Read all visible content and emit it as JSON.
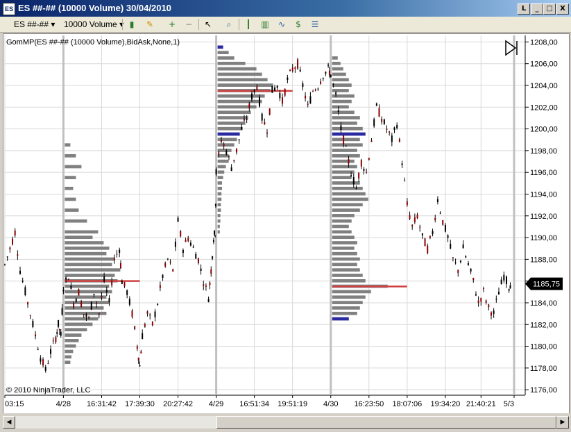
{
  "window": {
    "title": "ES ##-## (10000 Volume)  30/04/2010",
    "icon_label": "ES",
    "buttons": {
      "minimize": "_",
      "restore": "□",
      "close": "X",
      "extra": "L"
    }
  },
  "toolbar": {
    "instrument": "ES ##-##",
    "period": "10000 Volume",
    "icons": [
      "bar-style-icon",
      "drawing-pencil-icon",
      "zoom-in-icon",
      "zoom-out-icon",
      "cursor-icon",
      "search-icon",
      "bars-icon",
      "candles-icon",
      "indicator-icon",
      "strategy-icon",
      "properties-icon"
    ]
  },
  "chart_data": {
    "type": "candlestick",
    "indicator_label": "GomMP(ES ##-## (10000 Volume),BidAsk,None,1)",
    "copyright": "© 2010 NinjaTrader, LLC",
    "current_price": "1185,75",
    "last_price_value": 1185.75,
    "ylim": [
      1175.5,
      1208.6
    ],
    "y_ticks": [
      "1176,00",
      "1178,00",
      "1180,00",
      "1182,00",
      "1184,00",
      "1186,00",
      "1188,00",
      "1190,00",
      "1192,00",
      "1194,00",
      "1196,00",
      "1198,00",
      "1200,00",
      "1202,00",
      "1204,00",
      "1206,00",
      "1208,00"
    ],
    "y_tick_values": [
      1176,
      1178,
      1180,
      1182,
      1184,
      1186,
      1188,
      1190,
      1192,
      1194,
      1196,
      1198,
      1200,
      1202,
      1204,
      1206,
      1208
    ],
    "x_ticks": [
      "03:15",
      "4/28",
      "16:31:42",
      "17:39:30",
      "20:27:42",
      "4/29",
      "16:51:34",
      "19:51:19",
      "4/30",
      "16:23:50",
      "18:07:06",
      "19:34:20",
      "21:40:21",
      "5/3"
    ],
    "x_tick_fraction": [
      0.0,
      0.115,
      0.19,
      0.265,
      0.34,
      0.415,
      0.49,
      0.565,
      0.64,
      0.715,
      0.79,
      0.865,
      0.935,
      1.0
    ],
    "session_breaks_fraction": [
      0.115,
      0.415,
      0.64,
      1.0
    ],
    "price_path": [
      [
        0.0,
        1187.5
      ],
      [
        0.01,
        1189
      ],
      [
        0.02,
        1190.5
      ],
      [
        0.03,
        1187
      ],
      [
        0.04,
        1185
      ],
      [
        0.05,
        1183
      ],
      [
        0.06,
        1181
      ],
      [
        0.07,
        1179
      ],
      [
        0.08,
        1177.8
      ],
      [
        0.09,
        1179.5
      ],
      [
        0.1,
        1180.8
      ],
      [
        0.105,
        1182
      ],
      [
        0.11,
        1181
      ],
      [
        0.115,
        1185.5
      ],
      [
        0.125,
        1186.5
      ],
      [
        0.135,
        1184
      ],
      [
        0.145,
        1185
      ],
      [
        0.155,
        1183
      ],
      [
        0.165,
        1182.5
      ],
      [
        0.175,
        1185
      ],
      [
        0.185,
        1183
      ],
      [
        0.195,
        1186
      ],
      [
        0.205,
        1184
      ],
      [
        0.215,
        1188
      ],
      [
        0.225,
        1189
      ],
      [
        0.23,
        1186
      ],
      [
        0.24,
        1185
      ],
      [
        0.25,
        1183
      ],
      [
        0.26,
        1180
      ],
      [
        0.265,
        1178.2
      ],
      [
        0.27,
        1181
      ],
      [
        0.28,
        1183
      ],
      [
        0.29,
        1182
      ],
      [
        0.3,
        1184
      ],
      [
        0.31,
        1186.5
      ],
      [
        0.32,
        1188
      ],
      [
        0.33,
        1187
      ],
      [
        0.34,
        1191.5
      ],
      [
        0.35,
        1189
      ],
      [
        0.36,
        1190
      ],
      [
        0.37,
        1189
      ],
      [
        0.38,
        1188
      ],
      [
        0.39,
        1186
      ],
      [
        0.4,
        1184.5
      ],
      [
        0.405,
        1187
      ],
      [
        0.41,
        1190
      ],
      [
        0.413,
        1190.5
      ],
      [
        0.415,
        1196
      ],
      [
        0.425,
        1199
      ],
      [
        0.435,
        1198
      ],
      [
        0.445,
        1196.5
      ],
      [
        0.455,
        1198
      ],
      [
        0.465,
        1200
      ],
      [
        0.475,
        1201
      ],
      [
        0.485,
        1203
      ],
      [
        0.495,
        1204
      ],
      [
        0.505,
        1201
      ],
      [
        0.515,
        1200
      ],
      [
        0.525,
        1203.5
      ],
      [
        0.535,
        1204
      ],
      [
        0.545,
        1202.5
      ],
      [
        0.555,
        1204.5
      ],
      [
        0.565,
        1205.5
      ],
      [
        0.575,
        1206
      ],
      [
        0.585,
        1204
      ],
      [
        0.595,
        1202
      ],
      [
        0.605,
        1203.5
      ],
      [
        0.615,
        1204
      ],
      [
        0.625,
        1205
      ],
      [
        0.635,
        1205.5
      ],
      [
        0.64,
        1205
      ],
      [
        0.65,
        1203
      ],
      [
        0.66,
        1200
      ],
      [
        0.67,
        1198
      ],
      [
        0.68,
        1196
      ],
      [
        0.69,
        1194.5
      ],
      [
        0.7,
        1197
      ],
      [
        0.71,
        1196
      ],
      [
        0.72,
        1199
      ],
      [
        0.73,
        1202
      ],
      [
        0.74,
        1201
      ],
      [
        0.75,
        1200
      ],
      [
        0.76,
        1199
      ],
      [
        0.77,
        1200.5
      ],
      [
        0.78,
        1197
      ],
      [
        0.79,
        1193
      ],
      [
        0.8,
        1191
      ],
      [
        0.81,
        1192
      ],
      [
        0.82,
        1190
      ],
      [
        0.83,
        1189
      ],
      [
        0.84,
        1190.5
      ],
      [
        0.85,
        1193.5
      ],
      [
        0.86,
        1191.5
      ],
      [
        0.87,
        1190
      ],
      [
        0.88,
        1188
      ],
      [
        0.89,
        1187
      ],
      [
        0.9,
        1189
      ],
      [
        0.91,
        1187.5
      ],
      [
        0.92,
        1186
      ],
      [
        0.93,
        1184
      ],
      [
        0.94,
        1185
      ],
      [
        0.95,
        1183.5
      ],
      [
        0.96,
        1183
      ],
      [
        0.97,
        1185
      ],
      [
        0.98,
        1186.5
      ],
      [
        0.99,
        1185.5
      ],
      [
        0.995,
        1186
      ]
    ],
    "profiles": [
      {
        "session": "4/28",
        "start_fraction": 0.115,
        "poc": 1186,
        "value_area_blue": [
          1182.2,
          1189.7
        ],
        "levels": [
          [
            1198.5,
            0.1
          ],
          [
            1197.5,
            0.2
          ],
          [
            1196.5,
            0.3
          ],
          [
            1195.5,
            0.2
          ],
          [
            1194.5,
            0.15
          ],
          [
            1193.5,
            0.2
          ],
          [
            1192.5,
            0.25
          ],
          [
            1191.5,
            0.4
          ],
          [
            1190.5,
            0.6
          ],
          [
            1190,
            0.5
          ],
          [
            1189.5,
            0.7
          ],
          [
            1189,
            0.8
          ],
          [
            1188.5,
            0.75
          ],
          [
            1188,
            0.9
          ],
          [
            1187.5,
            0.85
          ],
          [
            1187,
            1.0
          ],
          [
            1186.5,
            0.9
          ],
          [
            1186,
            0.95
          ],
          [
            1185.5,
            0.8
          ],
          [
            1185,
            0.85
          ],
          [
            1184.5,
            0.75
          ],
          [
            1184,
            0.8
          ],
          [
            1183.5,
            0.7
          ],
          [
            1183,
            0.75
          ],
          [
            1182.5,
            0.6
          ],
          [
            1182,
            0.5
          ],
          [
            1181.5,
            0.4
          ],
          [
            1181,
            0.3
          ],
          [
            1180.5,
            0.25
          ],
          [
            1180,
            0.2
          ],
          [
            1179.5,
            0.15
          ],
          [
            1179,
            0.12
          ],
          [
            1178.5,
            0.1
          ]
        ]
      },
      {
        "session": "4/29",
        "start_fraction": 0.415,
        "poc": 1203.5,
        "value_area_blue": [
          1199.5,
          1207.5
        ],
        "levels": [
          [
            1207.5,
            0.1
          ],
          [
            1207,
            0.2
          ],
          [
            1206.5,
            0.3
          ],
          [
            1206,
            0.5
          ],
          [
            1205.5,
            0.7
          ],
          [
            1205,
            0.8
          ],
          [
            1204.5,
            0.9
          ],
          [
            1204,
            1.0
          ],
          [
            1203.5,
            0.95
          ],
          [
            1203,
            0.85
          ],
          [
            1202.5,
            0.8
          ],
          [
            1202,
            0.7
          ],
          [
            1201.5,
            0.6
          ],
          [
            1201,
            0.55
          ],
          [
            1200.5,
            0.5
          ],
          [
            1200,
            0.45
          ],
          [
            1199.5,
            0.4
          ],
          [
            1199,
            0.35
          ],
          [
            1198.5,
            0.3
          ],
          [
            1198,
            0.25
          ],
          [
            1197.5,
            0.2
          ],
          [
            1197,
            0.2
          ],
          [
            1196.5,
            0.15
          ],
          [
            1196,
            0.12
          ],
          [
            1195.5,
            0.1
          ],
          [
            1195,
            0.08
          ],
          [
            1194.5,
            0.08
          ],
          [
            1194,
            0.07
          ],
          [
            1193.5,
            0.07
          ],
          [
            1193,
            0.06
          ],
          [
            1192.5,
            0.06
          ],
          [
            1192,
            0.05
          ],
          [
            1191.5,
            0.05
          ],
          [
            1191,
            0.04
          ],
          [
            1190.5,
            0.04
          ]
        ]
      },
      {
        "session": "4/30",
        "start_fraction": 0.64,
        "poc": 1185.5,
        "value_area_blue": [
          1182.5,
          1199.5
        ],
        "levels": [
          [
            1206.5,
            0.1
          ],
          [
            1206,
            0.15
          ],
          [
            1205.5,
            0.2
          ],
          [
            1205,
            0.25
          ],
          [
            1204.5,
            0.3
          ],
          [
            1204,
            0.35
          ],
          [
            1203.5,
            0.3
          ],
          [
            1203,
            0.4
          ],
          [
            1202.5,
            0.35
          ],
          [
            1202,
            0.3
          ],
          [
            1201.5,
            0.4
          ],
          [
            1201,
            0.5
          ],
          [
            1200.5,
            0.45
          ],
          [
            1200,
            0.55
          ],
          [
            1199.5,
            0.6
          ],
          [
            1199,
            0.5
          ],
          [
            1198.5,
            0.55
          ],
          [
            1198,
            0.45
          ],
          [
            1197.5,
            0.5
          ],
          [
            1197,
            0.4
          ],
          [
            1196.5,
            0.45
          ],
          [
            1196,
            0.4
          ],
          [
            1195.5,
            0.35
          ],
          [
            1195,
            0.5
          ],
          [
            1194.5,
            0.55
          ],
          [
            1194,
            0.6
          ],
          [
            1193.5,
            0.65
          ],
          [
            1193,
            0.55
          ],
          [
            1192.5,
            0.5
          ],
          [
            1192,
            0.4
          ],
          [
            1191.5,
            0.35
          ],
          [
            1191,
            0.3
          ],
          [
            1190.5,
            0.35
          ],
          [
            1190,
            0.4
          ],
          [
            1189.5,
            0.45
          ],
          [
            1189,
            0.4
          ],
          [
            1188.5,
            0.45
          ],
          [
            1188,
            0.5
          ],
          [
            1187.5,
            0.45
          ],
          [
            1187,
            0.5
          ],
          [
            1186.5,
            0.55
          ],
          [
            1186,
            0.6
          ],
          [
            1185.5,
            1.0
          ],
          [
            1185,
            0.7
          ],
          [
            1184.5,
            0.6
          ],
          [
            1184,
            0.55
          ],
          [
            1183.5,
            0.5
          ],
          [
            1183,
            0.45
          ],
          [
            1182.5,
            0.3
          ]
        ]
      }
    ],
    "colors": {
      "up": "#000000",
      "down": "#8b0000",
      "profile": "#808080",
      "poc": "#d04040",
      "value_area": "#2a2aa0",
      "grid": "#d8d8d8",
      "session": "#c0c0c0"
    }
  }
}
